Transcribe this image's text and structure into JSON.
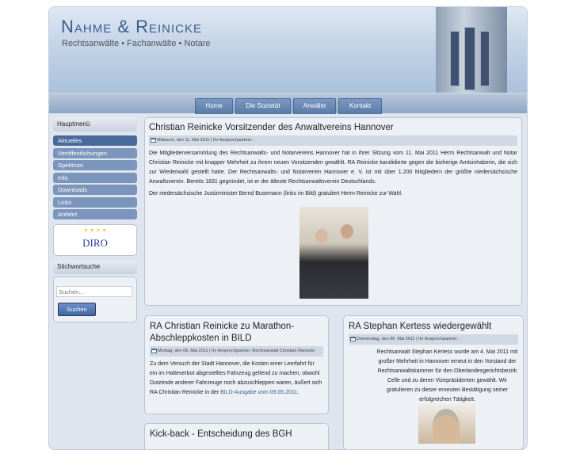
{
  "header": {
    "logo": "Nahme & Reinicke",
    "tagline": "Rechtsanwälte • Fachanwälte • Notare"
  },
  "nav": [
    "Home",
    "Die Sozietät",
    "Anwälte",
    "Kontakt"
  ],
  "sidebar": {
    "menu_title": "Hauptmenü",
    "items": [
      "Aktuelles",
      "Veröffentlichungen",
      "Spektrum",
      "Info",
      "Downloads",
      "Links",
      "Anfahrt"
    ],
    "diro_logo": "DIRO",
    "search_title": "Stichwortsuche",
    "search_placeholder": "Suchen...",
    "search_button": "Suchen"
  },
  "articles": [
    {
      "title": "Christian Reinicke Vorsitzender des Anwaltvereins Hannover",
      "meta": "Mittwoch, den 11. Mai 2011 | Ihr Ansprechpartner: .",
      "paragraphs": [
        "Die Mitgliederversammlung des Rechtsanwalts- und Notarvereins Hannover hat in ihrer Sitzung vom 11. Mai 2011 Herrn Rechtsanwalt und Notar Christian Reinicke mit knapper Mehrheit zu ihrem neuen Vorsitzenden gewählt. RA Reinicke kandidierte gegen die bisherige Amtsinhaberin, die sich zur Wiederwahl gestellt hatte. Der Rechtsanwalts- und Notarverein Hannover e. V. ist mit über 1.200 Mitgliedern der größte niedersächsische Anwaltsverein. Bereits 1831 gegründet, ist er der älteste Rechtsanwaltsverein Deutschlands.",
        "Der niedersächsische Justizminister Bernd Busemann (links im Bild) gratuliert Herrn Reinicke zur Wahl."
      ]
    },
    {
      "title": "RA Christian Reinicke zu Marathon-Abschleppkosten in BILD",
      "meta": "Montag, den 09. Mai 2011 | Ihr Ansprechpartner: Rechtsanwalt Christian Reinicke",
      "text": "Zu dem Versuch der Stadt Hannover, die Kosten einer Leerfahrt für ein im Halteverbot abgestelltes Fahrzeug geltend zu machen, obwohl Dutzende anderer Fahrzeuge noch abzuschleppen waren, äußert sich RA Christian Reinicke in der",
      "link": "BILD-Ausgabe vom 09.05.2011",
      "tail": "."
    },
    {
      "title": "RA Stephan Kertess wiedergewählt",
      "meta": "Donnerstag, den 05. Mai 2011 | Ihr Ansprechpartner: .",
      "text": "Rechtsanwalt Stephan Kertess wurde am 4. Mai 2011 mit großer Mehrheit in Hannover erneut in den Vorstand der Rechtsanwaltskammer für den Oberlandesgerichtsbezirk Celle und zu deren Vizepräsidenten gewählt. Wir gratulieren zu dieser erneuten Bestätigung seiner erfolgreichen Tätigkeit."
    },
    {
      "title": "Kick-back - Entscheidung des BGH"
    }
  ]
}
